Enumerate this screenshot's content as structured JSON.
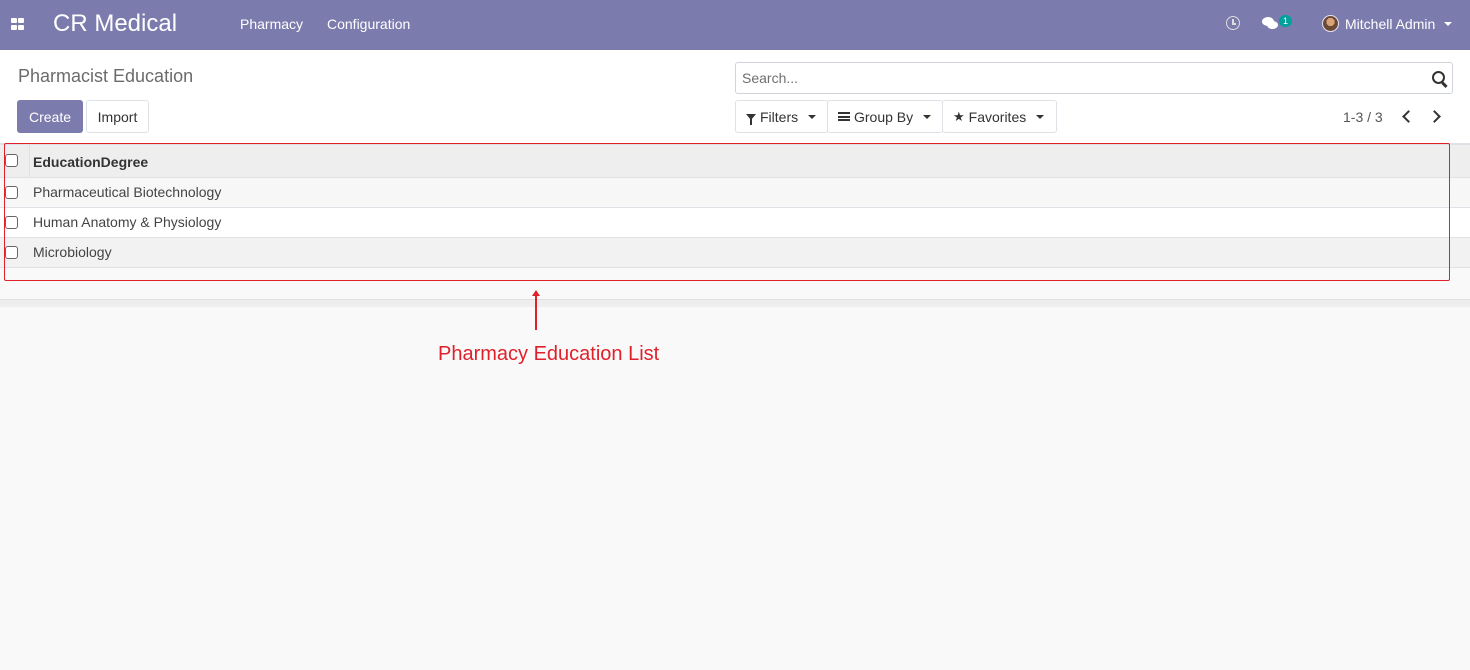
{
  "navbar": {
    "brand": "CR Medical",
    "menu": [
      {
        "label": "Pharmacy"
      },
      {
        "label": "Configuration"
      }
    ],
    "chat_badge": "1",
    "user_name": "Mitchell Admin",
    "icons": [
      "apps-grid-icon",
      "clock-icon",
      "chat-icon",
      "avatar"
    ]
  },
  "control_panel": {
    "title": "Pharmacist Education",
    "create_label": "Create",
    "import_label": "Import",
    "search_placeholder": "Search...",
    "filters_label": "Filters",
    "group_by_label": "Group By",
    "favorites_label": "Favorites",
    "pager_value": "1-3 / 3"
  },
  "list": {
    "columns": [
      "EducationDegree"
    ],
    "rows": [
      {
        "education_degree": "Pharmaceutical Biotechnology"
      },
      {
        "education_degree": "Human Anatomy & Physiology"
      },
      {
        "education_degree": "Microbiology"
      }
    ]
  },
  "annotation": {
    "label": "Pharmacy Education List",
    "color": "#e0202a"
  },
  "colors": {
    "primary": "#7c7bad",
    "badge": "#00a09d"
  }
}
